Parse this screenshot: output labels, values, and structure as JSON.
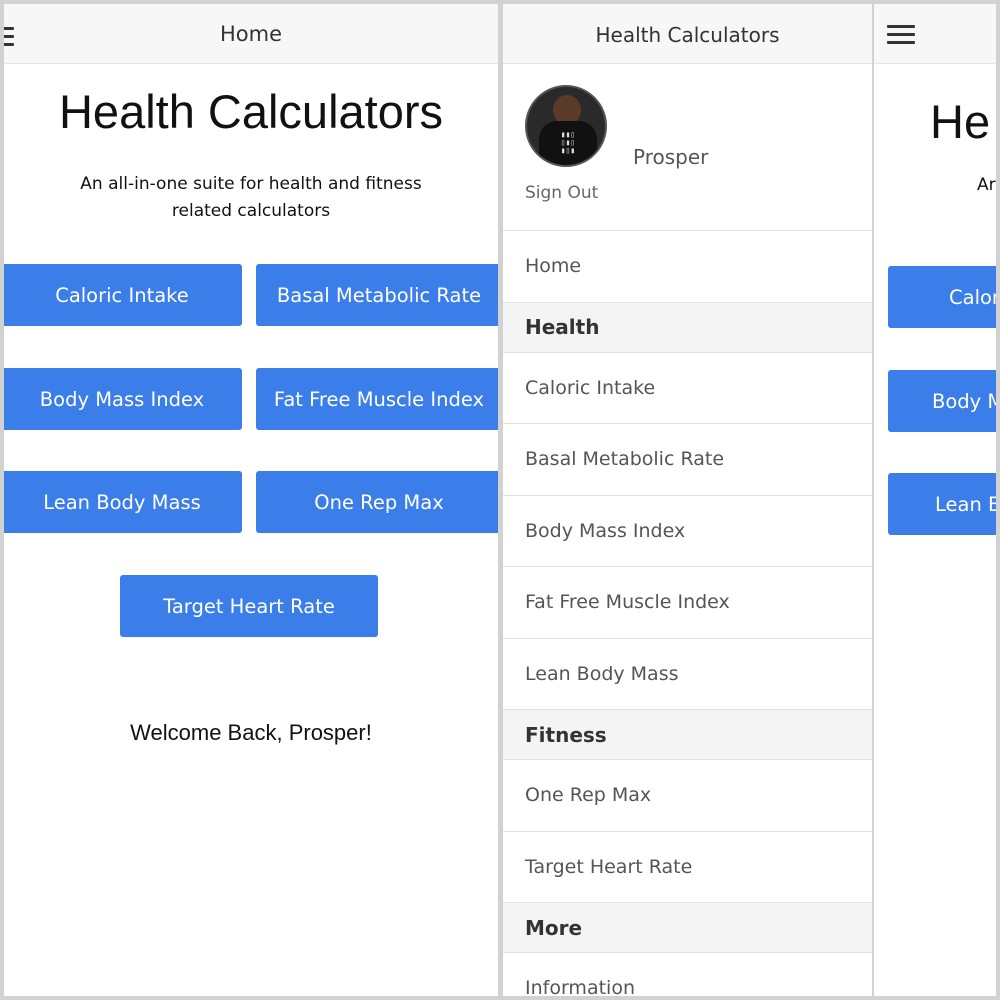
{
  "screen1": {
    "nav_title": "Home",
    "heading": "Health Calculators",
    "subtitle_line1": "An all-in-one suite for health and fitness",
    "subtitle_line2": "related calculators",
    "buttons": [
      "Caloric Intake",
      "Basal Metabolic Rate",
      "Body Mass Index",
      "Fat Free Muscle Index",
      "Lean Body Mass",
      "One Rep Max",
      "Target Heart Rate"
    ],
    "welcome": "Welcome Back, Prosper!"
  },
  "screen2": {
    "nav_title": "Health Calculators",
    "user_name": "Prosper",
    "sign_out": "Sign Out",
    "menu": {
      "home": "Home",
      "health_header": "Health",
      "health_items": [
        "Caloric Intake",
        "Basal Metabolic Rate",
        "Body Mass Index",
        "Fat Free Muscle Index",
        "Lean Body Mass"
      ],
      "fitness_header": "Fitness",
      "fitness_items": [
        "One Rep Max",
        "Target Heart Rate"
      ],
      "more_header": "More",
      "more_items": [
        "Information"
      ]
    }
  },
  "screen3": {
    "heading_partial": "He",
    "subtitle_partial": "Ar",
    "buttons_partial": [
      "Calor",
      "Body M",
      "Lean B"
    ]
  },
  "colors": {
    "accent": "#3b7de9",
    "navbar_bg": "#f7f7f7",
    "section_header_bg": "#f4f4f4"
  }
}
